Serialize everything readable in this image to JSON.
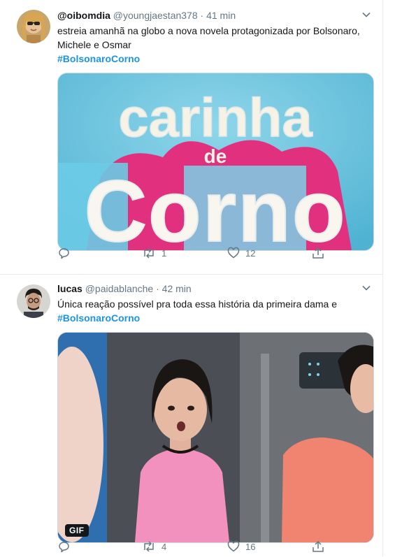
{
  "tweets": [
    {
      "display_name": "@oibomdia",
      "handle": "@youngjaestan378",
      "time": "41 min",
      "text_line1": "estreia amanhã na globo a nova novela protagonizada por Bolsonaro,",
      "text_line2": "Michele e Osmar",
      "hashtag": "#BolsonaroCorno",
      "media_title_top": "carinha",
      "media_title_mid": "de",
      "media_title_bottom": "Corno",
      "replies": "",
      "retweets": "1",
      "likes": "12"
    },
    {
      "display_name": "lucas",
      "handle": "@paidablanche",
      "time": "42 min",
      "text_line1": "Única reação possível pra toda essa história da primeira dama e",
      "hashtag": "#BolsonaroCorno",
      "gif_label": "GIF",
      "replies": "",
      "retweets": "4",
      "likes": "16"
    }
  ],
  "colors": {
    "link": "#1b95e0",
    "meta": "#657786",
    "divider": "#e6ecf0"
  },
  "icons": [
    "chevron-down-icon",
    "reply-icon",
    "retweet-icon",
    "like-icon",
    "share-icon"
  ]
}
